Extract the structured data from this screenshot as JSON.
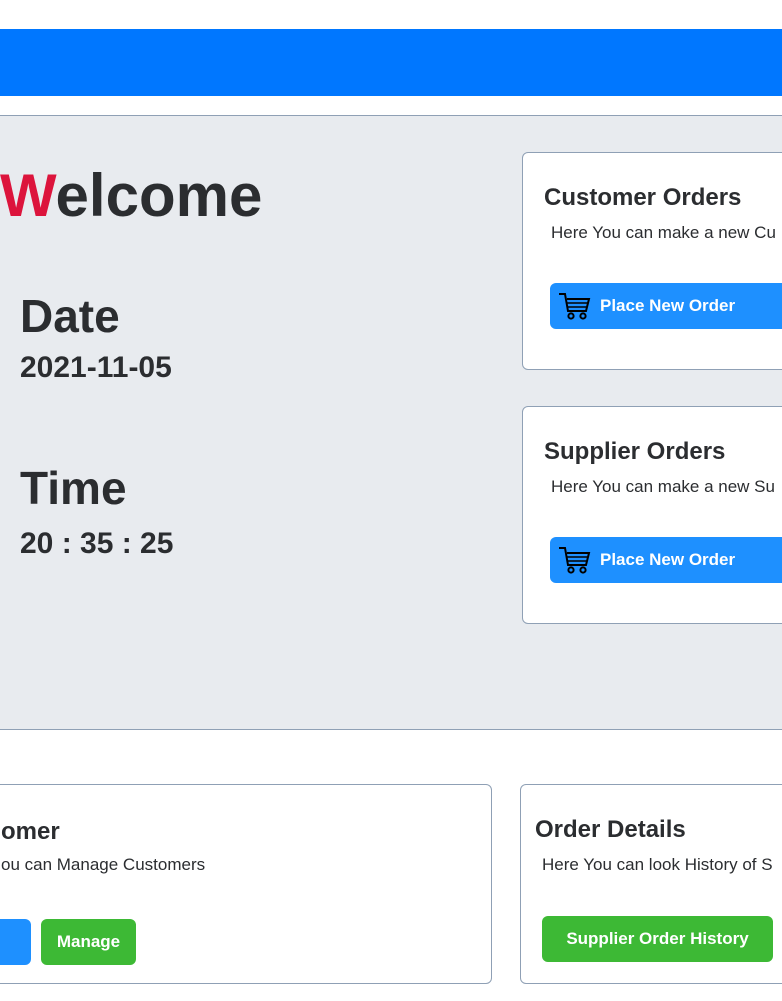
{
  "hero": {
    "welcome_first": "W",
    "welcome_rest": "elcome",
    "date_label": "Date",
    "date_value": "2021-11-05",
    "time_label": "Time",
    "time_value": "20 : 35 : 25"
  },
  "customer_orders": {
    "title": "Customer Orders",
    "description": "Here You can make a new Cu",
    "button_label": "Place New Order",
    "button_icon": "cart-icon"
  },
  "supplier_orders": {
    "title": "Supplier Orders",
    "description": "Here You can make a new Su",
    "button_label": "Place New Order",
    "button_icon": "cart-icon"
  },
  "customer_panel": {
    "title": "omer",
    "description": "ou can  Manage Customers",
    "manage_label": "Manage"
  },
  "order_details": {
    "title": "Order Details",
    "description": "Here You can  look History of S",
    "history_label": "Supplier Order History"
  },
  "colors": {
    "topbar": "#0077ff",
    "accent_red": "#dc143c",
    "button_blue": "#1e90ff",
    "button_green": "#3db935",
    "hero_bg": "#e8ebef"
  }
}
